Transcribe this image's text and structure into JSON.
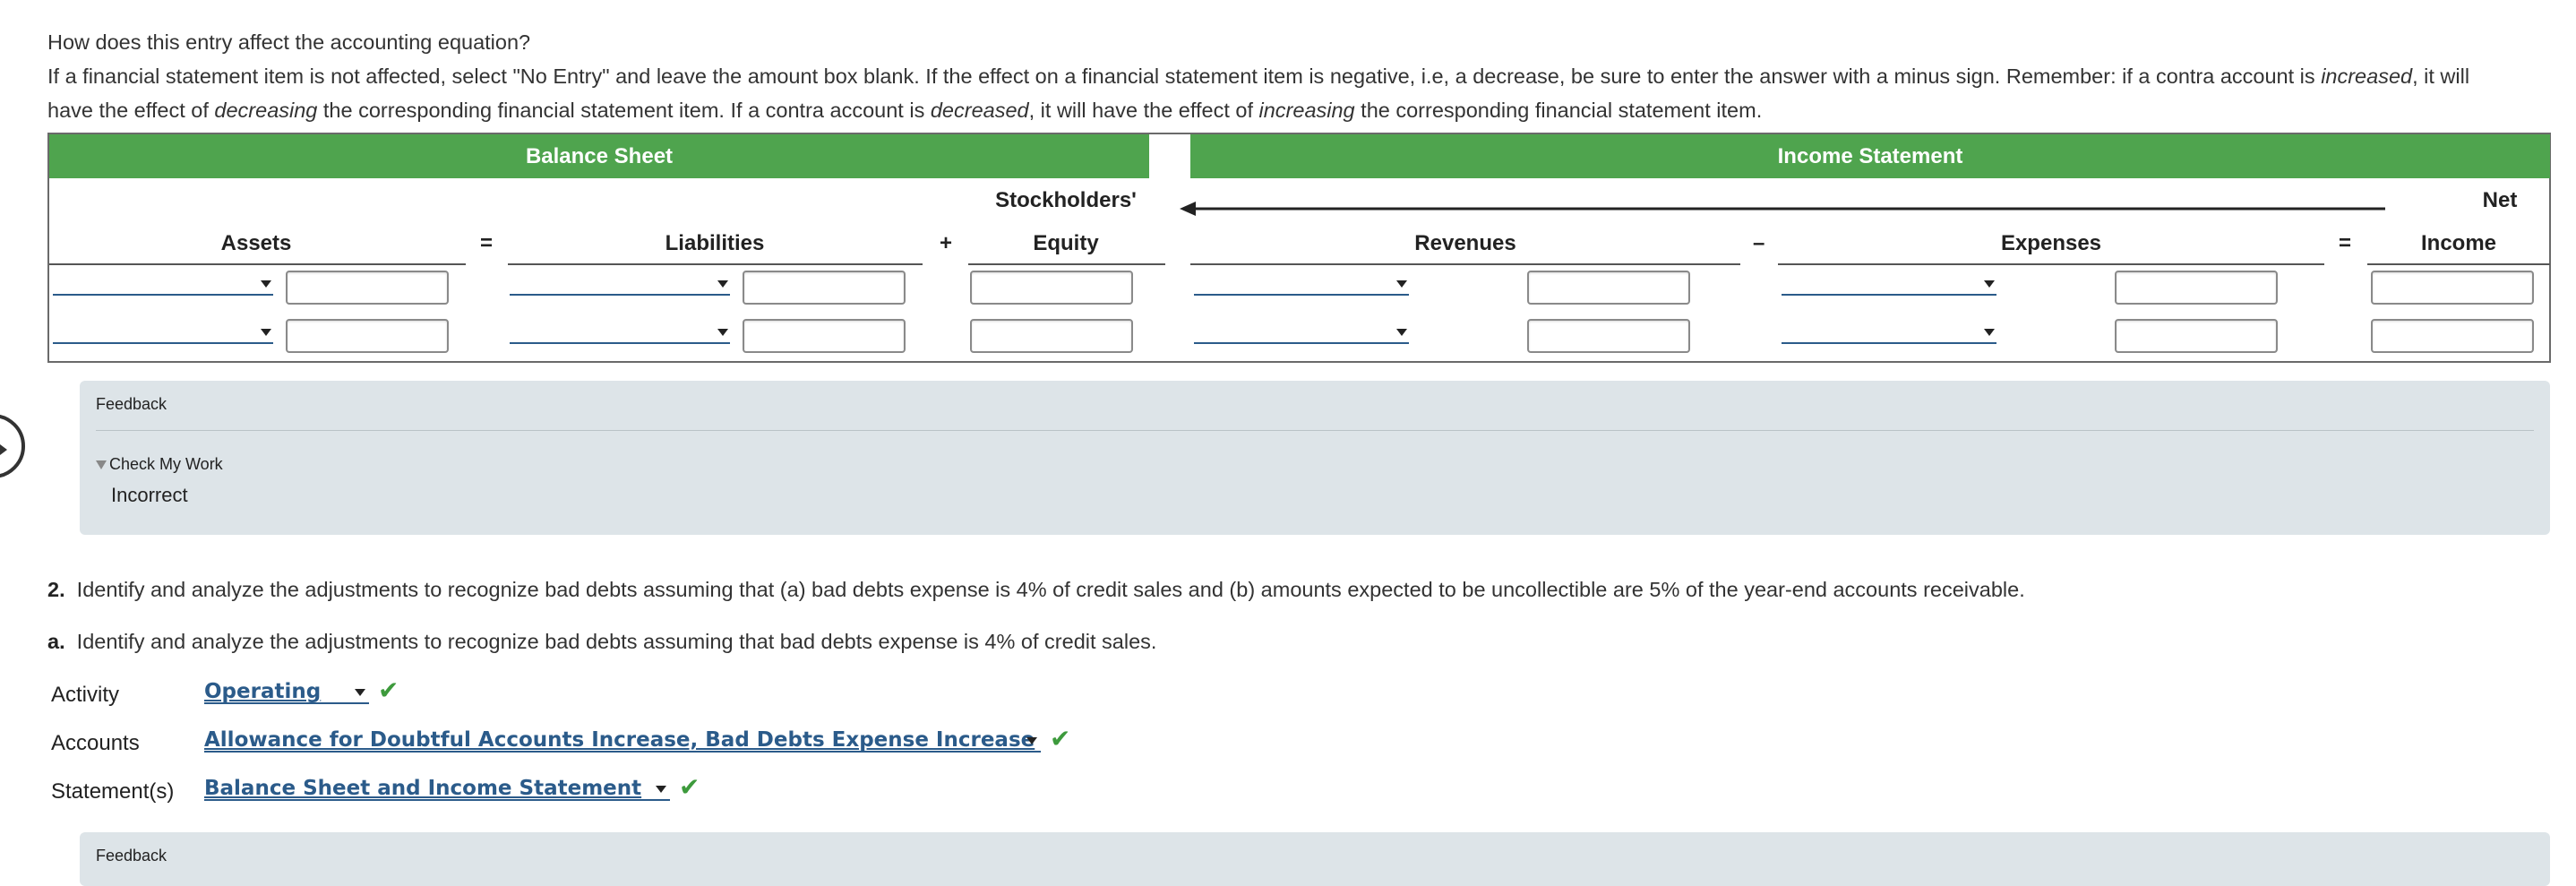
{
  "question": {
    "prompt": "How does this entry affect the accounting equation?",
    "instr_a": "If a financial statement item is not affected, select \"No Entry\" and leave the amount box blank. If the effect on a financial statement item is negative, i.e, a decrease, be sure to enter the answer with a minus sign. Remember: if a contra account is ",
    "instr_increased": "increased",
    "instr_b": ", it will have the effect of ",
    "instr_decreasing": "decreasing",
    "instr_c": " the corresponding financial statement item. If a contra account is ",
    "instr_decreased": "decreased",
    "instr_d": ", it will have the effect of ",
    "instr_increasing": "increasing",
    "instr_e": " the corresponding financial statement item."
  },
  "table": {
    "balance_sheet": "Balance Sheet",
    "income_statement": "Income Statement",
    "assets": "Assets",
    "liabilities": "Liabilities",
    "stockholders": "Stockholders'",
    "equity": "Equity",
    "revenues": "Revenues",
    "expenses": "Expenses",
    "net": "Net",
    "income": "Income",
    "eq1": "=",
    "plus": "+",
    "minus": "–",
    "eq2": "="
  },
  "feedback1": {
    "title": "Feedback",
    "check_my_work": "Check My Work",
    "status": "Incorrect"
  },
  "part2": {
    "num": "2.",
    "text": "Identify and analyze the adjustments to recognize bad debts assuming that (a) bad debts expense is 4% of credit sales and (b) amounts expected to be uncollectible are 5% of the year-end accounts receivable."
  },
  "part_a": {
    "letter": "a.",
    "text": "Identify and analyze the adjustments to recognize bad debts assuming that bad debts expense is 4% of credit sales."
  },
  "answers": {
    "activity_label": "Activity",
    "activity_value": "Operating",
    "accounts_label": "Accounts",
    "accounts_value": "Allowance for Doubtful Accounts Increase, Bad Debts Expense Increase",
    "statements_label": "Statement(s)",
    "statements_value": "Balance Sheet and Income Statement",
    "check_mark": "✔"
  },
  "feedback2": {
    "title": "Feedback"
  },
  "colors": {
    "band_green": "#4fa44e",
    "link_blue": "#2b5b8a",
    "check_green": "#3d9a3c",
    "feedback_bg": "#dde4e8"
  }
}
